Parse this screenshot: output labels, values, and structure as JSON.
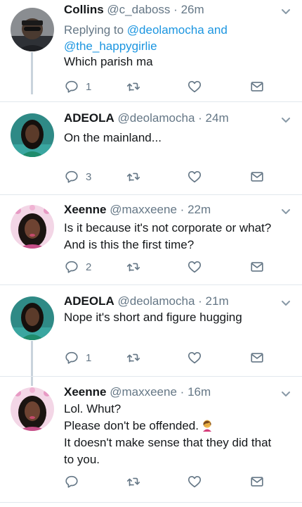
{
  "colors": {
    "text": "#14171a",
    "secondary": "#657786",
    "link": "#1b95e0",
    "divider": "#e1e8ed",
    "thread": "#c9d3dc"
  },
  "icons": {
    "reply": "reply-icon",
    "retweet": "retweet-icon",
    "like": "heart-icon",
    "message": "envelope-icon",
    "menu": "chevron-down-icon"
  },
  "tweets": [
    {
      "name": "Collins",
      "handle": "@c_daboss",
      "dot": "·",
      "time": "26m",
      "replying_prefix": "Replying to",
      "replying_user1": "@deolamocha",
      "replying_and": "and",
      "replying_user2": "@the_happygirlie",
      "lines": [
        "Which parish ma"
      ],
      "reply_count": "1",
      "retweet_count": "",
      "like_count": ""
    },
    {
      "name": "ADEOLA",
      "handle": "@deolamocha",
      "dot": "·",
      "time": "24m",
      "lines": [
        "On the mainland..."
      ],
      "reply_count": "3",
      "retweet_count": "",
      "like_count": ""
    },
    {
      "name": "Xeenne",
      "handle": "@maxxeene",
      "dot": "·",
      "time": "22m",
      "lines": [
        "Is it because it's not corporate or what?",
        "And is this the first time?"
      ],
      "reply_count": "2",
      "retweet_count": "",
      "like_count": ""
    },
    {
      "name": "ADEOLA",
      "handle": "@deolamocha",
      "dot": "·",
      "time": "21m",
      "lines": [
        "Nope it's short and figure hugging"
      ],
      "reply_count": "1",
      "retweet_count": "",
      "like_count": ""
    },
    {
      "name": "Xeenne",
      "handle": "@maxxeene",
      "dot": "·",
      "time": "16m",
      "lines": [
        "Lol. Whut?",
        "Please don't be offended.",
        "It doesn't make sense that they did that",
        "to you."
      ],
      "emoji": "woman-facepalming-emoji",
      "reply_count": "",
      "retweet_count": "",
      "like_count": ""
    }
  ]
}
